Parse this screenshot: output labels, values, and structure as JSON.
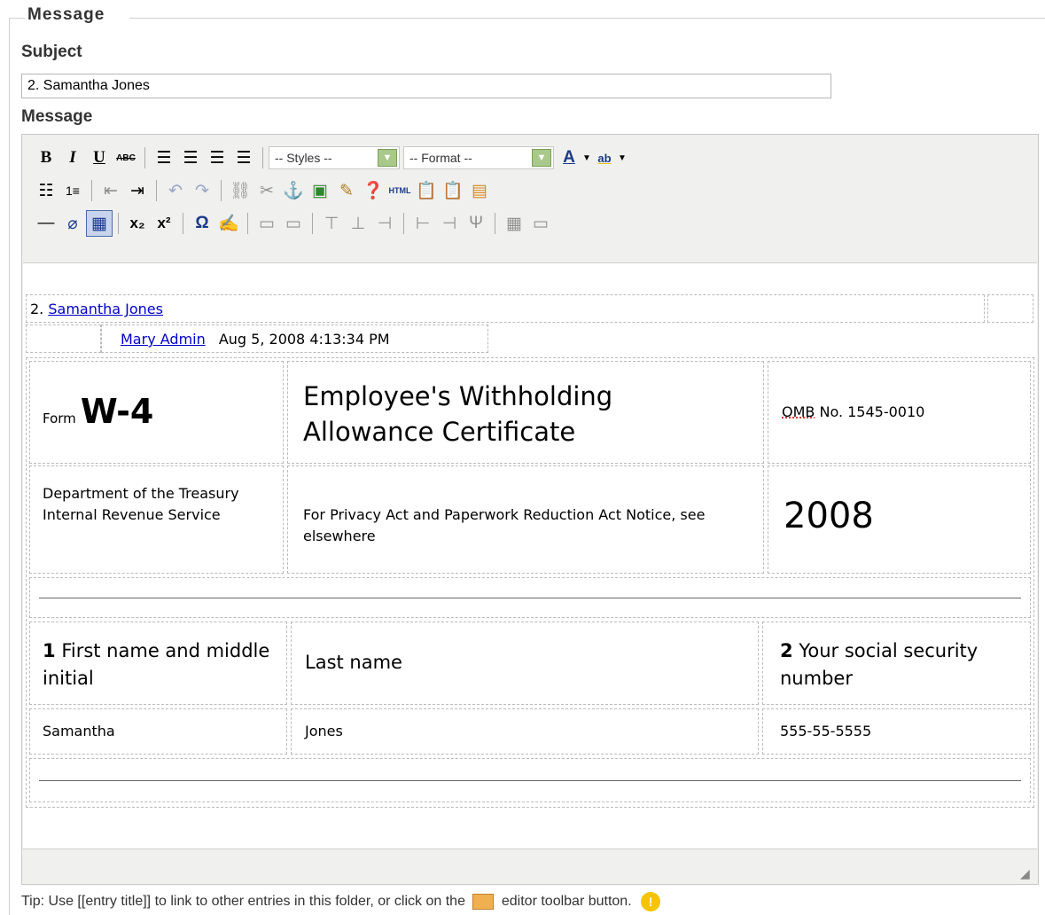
{
  "fieldset": {
    "legend": "Message"
  },
  "subject": {
    "label": "Subject",
    "value": "2. Samantha Jones"
  },
  "message": {
    "label": "Message"
  },
  "toolbar": {
    "bold": "B",
    "italic": "I",
    "underline": "U",
    "strike": "ABC",
    "styles_select": "-- Styles --",
    "format_select": "-- Format --",
    "html_button": "HTML",
    "font_color": "A",
    "highlight": "ab"
  },
  "content": {
    "title_prefix": "2.",
    "title_link": "Samantha Jones",
    "author": "Mary Admin",
    "date": "Aug 5, 2008 4:13:34 PM",
    "form": {
      "form_label": "Form",
      "form_code": "W-4",
      "title": "Employee's Withholding Allowance Certificate",
      "omb_prefix": "OMB",
      "omb_rest": "No. 1545-0010",
      "dept": "Department of the Treasury Internal Revenue Service",
      "privacy": "For Privacy Act and Paperwork Reduction Act Notice, see elsewhere",
      "year": "2008",
      "f1_num": "1",
      "f1_label": "First name and middle initial",
      "last_label": "Last name",
      "f2_num": "2",
      "f2_label": "Your social security number",
      "first_value": "Samantha",
      "last_value": "Jones",
      "ssn_value": "555-55-5555"
    }
  },
  "tip": {
    "before": "Tip: Use [[entry title]] to link to other entries in this folder, or click on the",
    "after": "editor toolbar button."
  }
}
